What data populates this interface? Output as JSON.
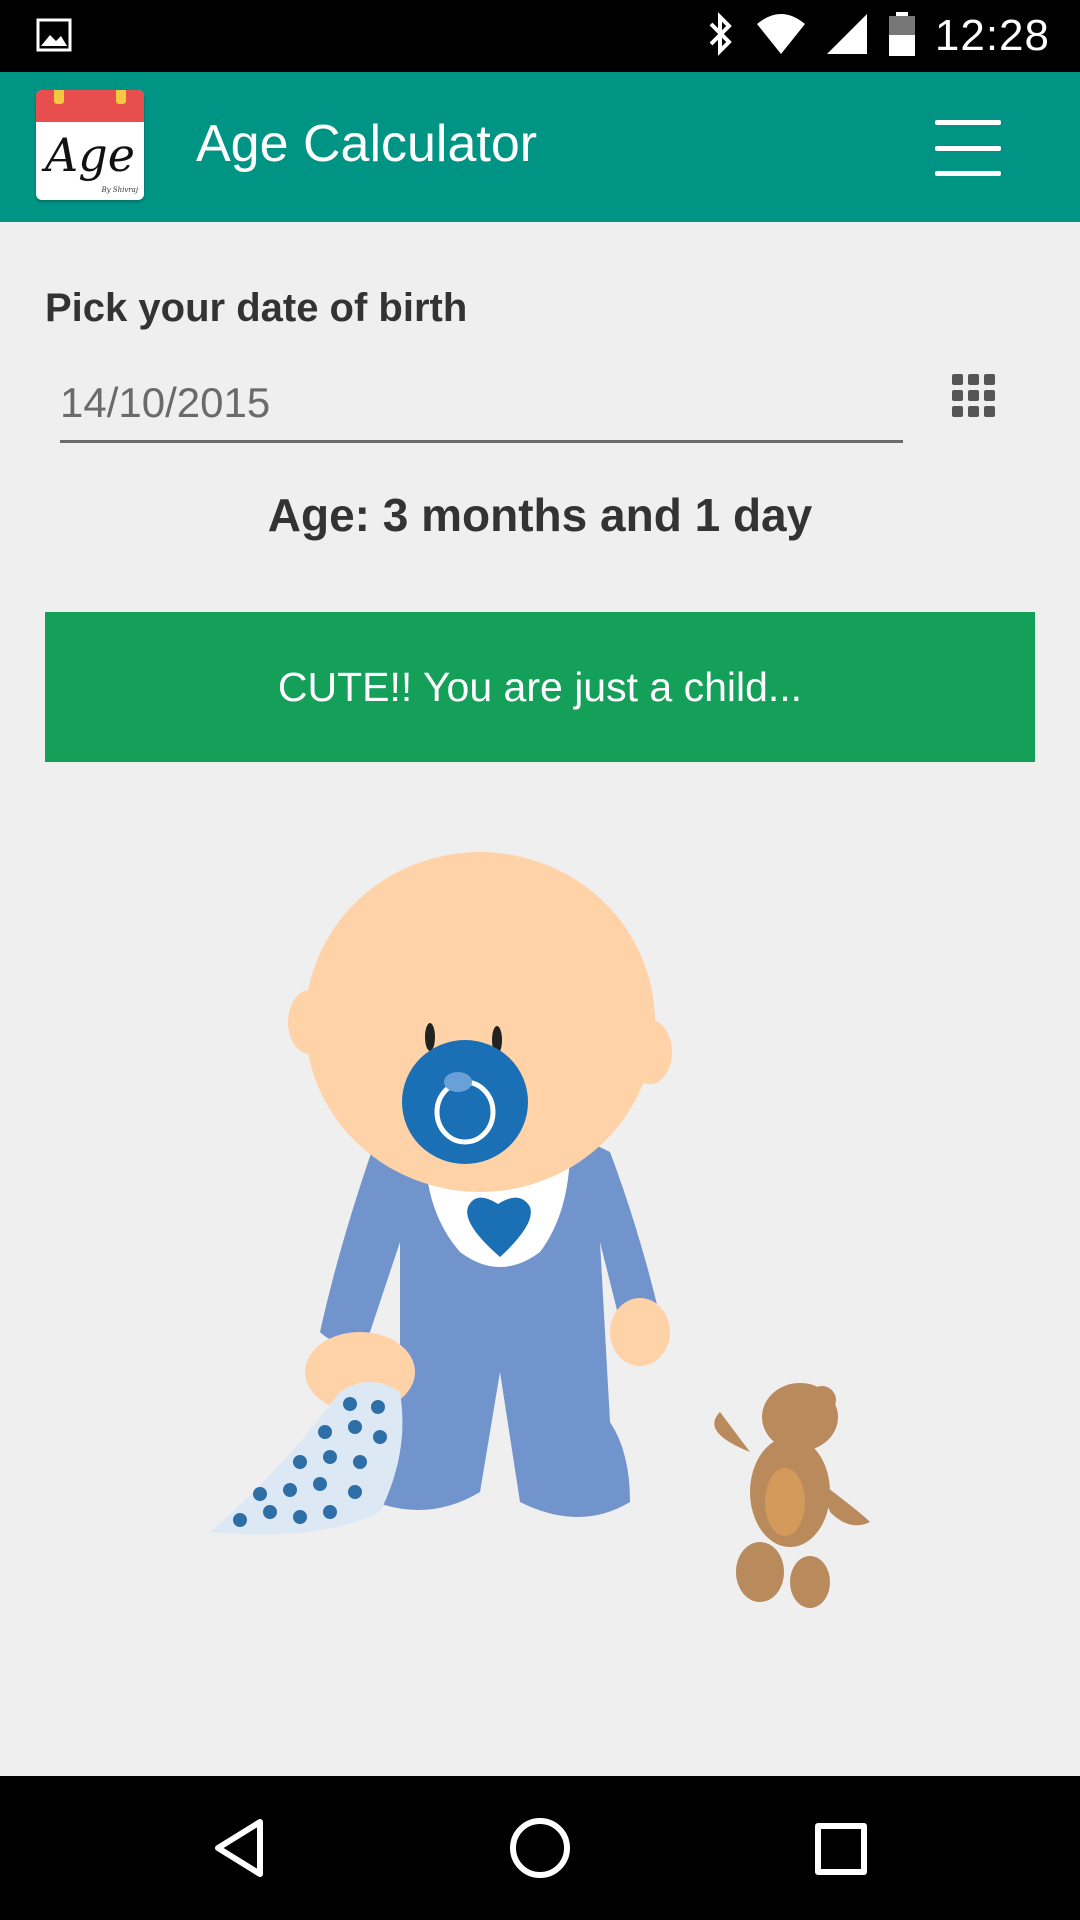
{
  "status_bar": {
    "time": "12:28",
    "icons": [
      "image-notification-icon",
      "bluetooth-icon",
      "wifi-icon",
      "cell-signal-icon",
      "battery-icon"
    ]
  },
  "app_bar": {
    "title": "Age Calculator",
    "logo": {
      "text": "Age",
      "subtext": "By Shivraj"
    },
    "menu_icon": "hamburger-menu-icon"
  },
  "form": {
    "label": "Pick your date of birth",
    "date_value": "14/10/2015",
    "picker_icon": "calendar-grid-icon"
  },
  "result": {
    "age_text": "Age: 3 months and 1 day",
    "message": "CUTE!! You are just a child..."
  },
  "illustration": {
    "subject": "baby-with-pacifier-blanket-and-teddy-bear"
  },
  "colors": {
    "app_bar": "#009485",
    "banner": "#15a05a",
    "background": "#efefef",
    "logo_header": "#e84e4e"
  },
  "nav_bar": {
    "buttons": [
      "back-icon",
      "home-icon",
      "recents-icon"
    ]
  }
}
